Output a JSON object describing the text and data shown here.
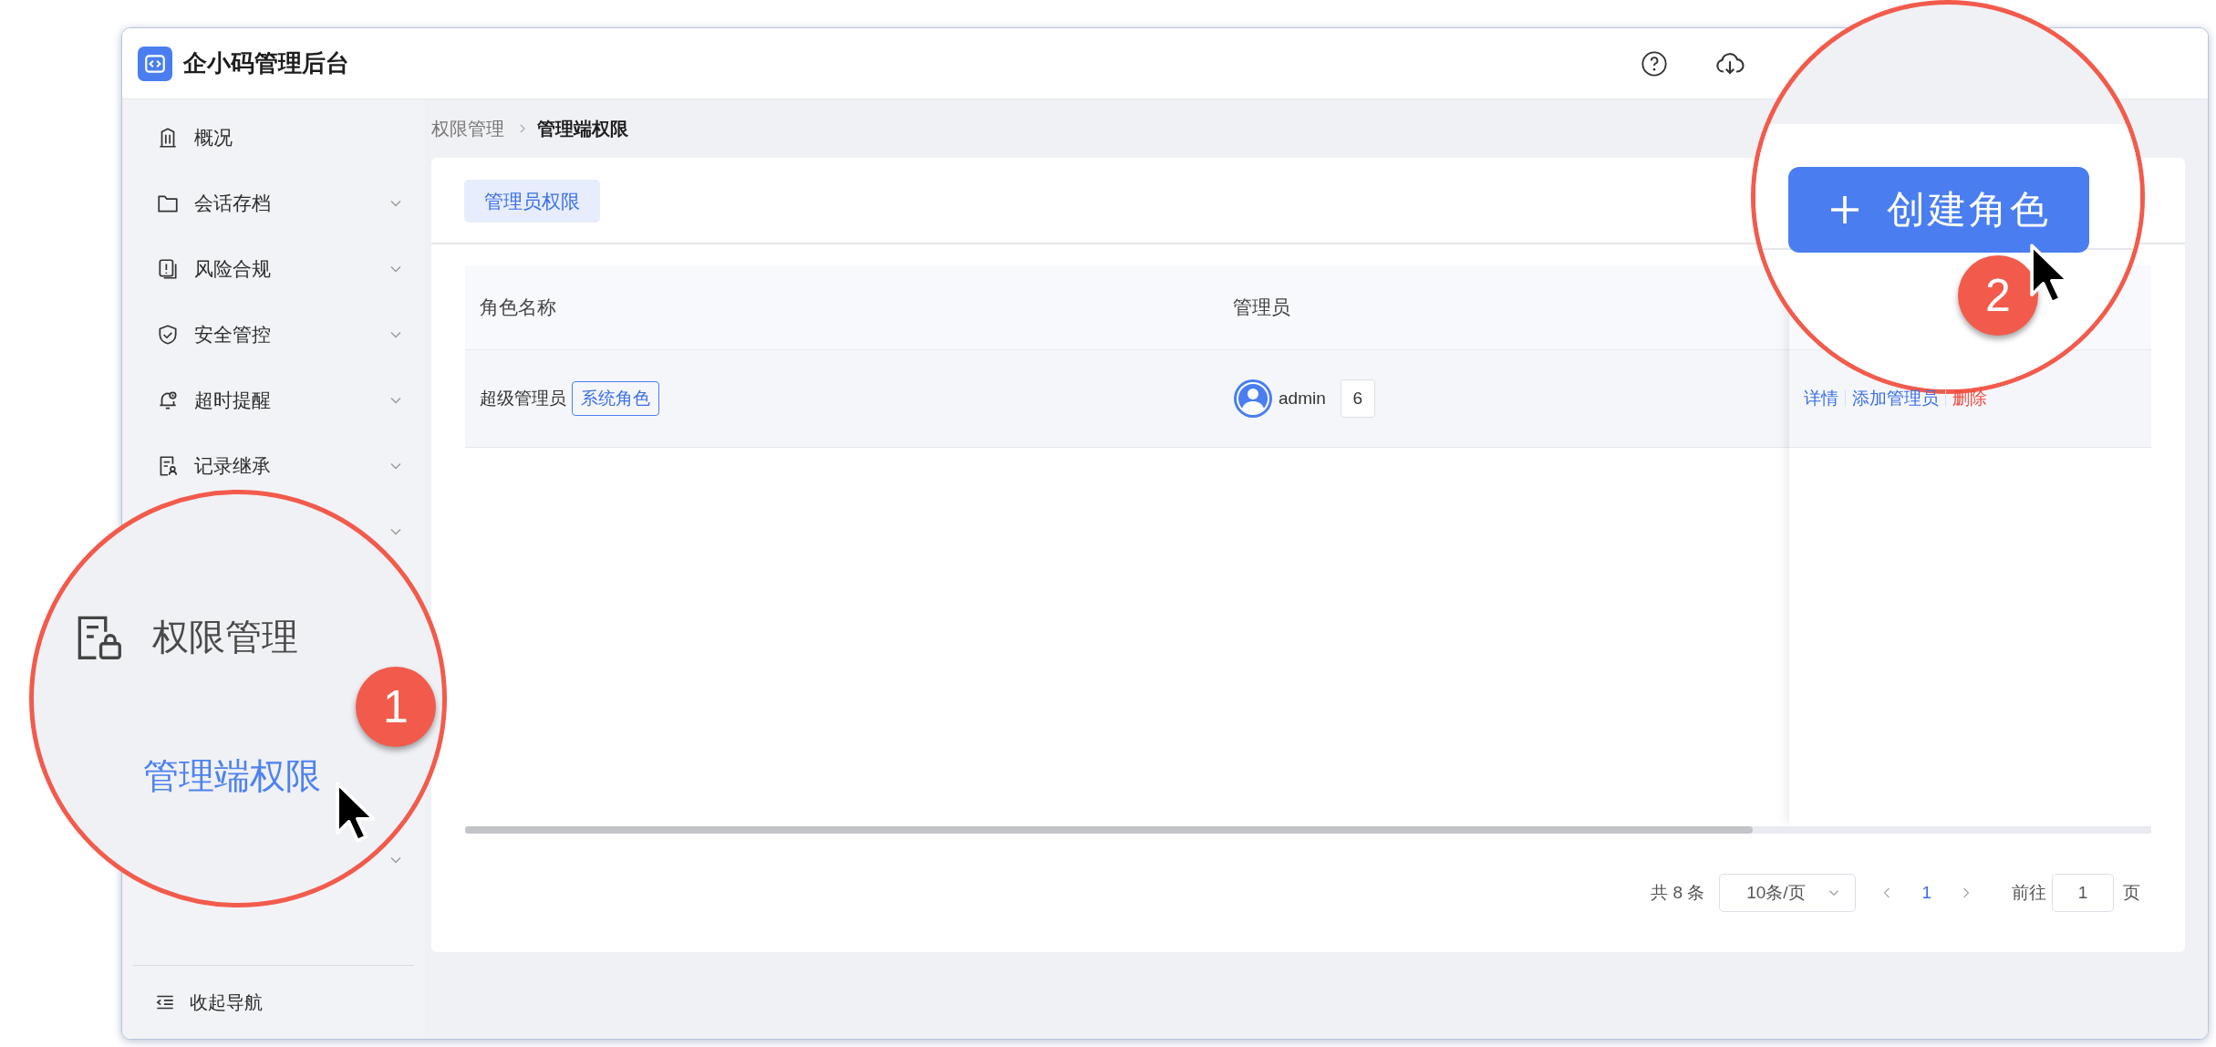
{
  "app": {
    "title": "企小码管理后台"
  },
  "sidebar": {
    "items": [
      {
        "label": "概况",
        "kind": "building",
        "expandable": false
      },
      {
        "label": "会话存档",
        "kind": "folder",
        "expandable": true
      },
      {
        "label": "风险合规",
        "kind": "alert",
        "expandable": true
      },
      {
        "label": "安全管控",
        "kind": "shield",
        "expandable": true
      },
      {
        "label": "超时提醒",
        "kind": "bell",
        "expandable": true
      },
      {
        "label": "记录继承",
        "kind": "record",
        "expandable": true
      }
    ],
    "covered_rows": [
      {
        "expandable": true
      },
      {
        "expandable": true
      }
    ],
    "collapse_label": "收起导航"
  },
  "breadcrumb": [
    "权限管理",
    "管理端权限"
  ],
  "tabs": [
    {
      "label": "管理员权限",
      "selected": true
    }
  ],
  "table": {
    "columns": [
      "角色名称",
      "管理员"
    ],
    "rows": [
      {
        "role": "超级管理员",
        "tag": "系统角色",
        "admin": "admin",
        "admin_count": "6",
        "actions": [
          {
            "label": "详情",
            "kind": "link"
          },
          {
            "label": "添加管理员",
            "kind": "link"
          },
          {
            "label": "删除",
            "kind": "danger"
          }
        ]
      }
    ]
  },
  "pagination": {
    "total": "共 8 条",
    "page_size": "10条/页",
    "pages": [
      {
        "label": "1",
        "selected": true
      }
    ],
    "goto_label": "前往",
    "goto_value": "1",
    "page_unit": "页"
  },
  "callouts": [
    {
      "kind": "menu",
      "number": "1",
      "section": "权限管理",
      "item": "管理端权限"
    },
    {
      "kind": "button",
      "number": "2",
      "button": "创建角色"
    }
  ]
}
